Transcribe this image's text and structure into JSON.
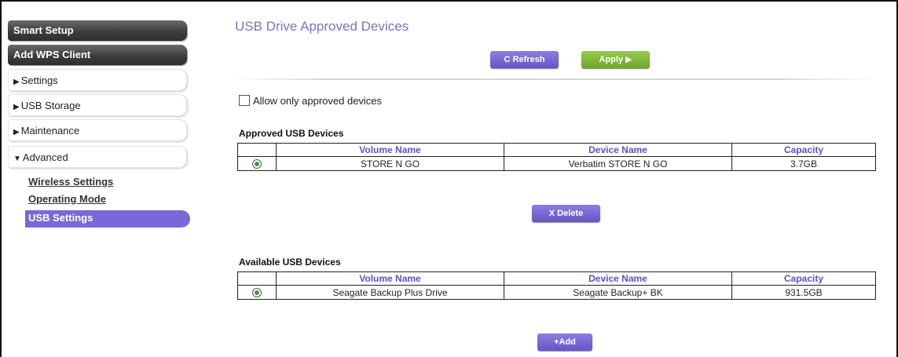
{
  "sidebar": {
    "smart_setup": "Smart Setup",
    "add_wps": "Add WPS Client",
    "menu": [
      {
        "label": "Settings",
        "arrow": "▶"
      },
      {
        "label": "USB Storage",
        "arrow": "▶"
      },
      {
        "label": "Maintenance",
        "arrow": "▶"
      },
      {
        "label": "Advanced",
        "arrow": "▼"
      }
    ],
    "sub": {
      "wireless": "Wireless Settings",
      "operating": "Operating Mode",
      "usb": "USB Settings"
    }
  },
  "main": {
    "title": "USB Drive Approved Devices",
    "refresh": "C Refresh",
    "apply": "Apply ▶",
    "allow_label": "Allow only approved devices",
    "approved": {
      "title": "Approved USB Devices",
      "headers": [
        "Volume Name",
        "Device Name",
        "Capacity"
      ],
      "rows": [
        {
          "volume": "STORE N GO",
          "device": "Verbatim STORE N GO",
          "capacity": "3.7GB"
        }
      ]
    },
    "delete": "X Delete",
    "available": {
      "title": "Available USB Devices",
      "headers": [
        "Volume Name",
        "Device Name",
        "Capacity"
      ],
      "rows": [
        {
          "volume": "Seagate Backup Plus Drive",
          "device": "Seagate Backup+ BK",
          "capacity": "931.5GB"
        }
      ]
    },
    "add": "+Add"
  }
}
